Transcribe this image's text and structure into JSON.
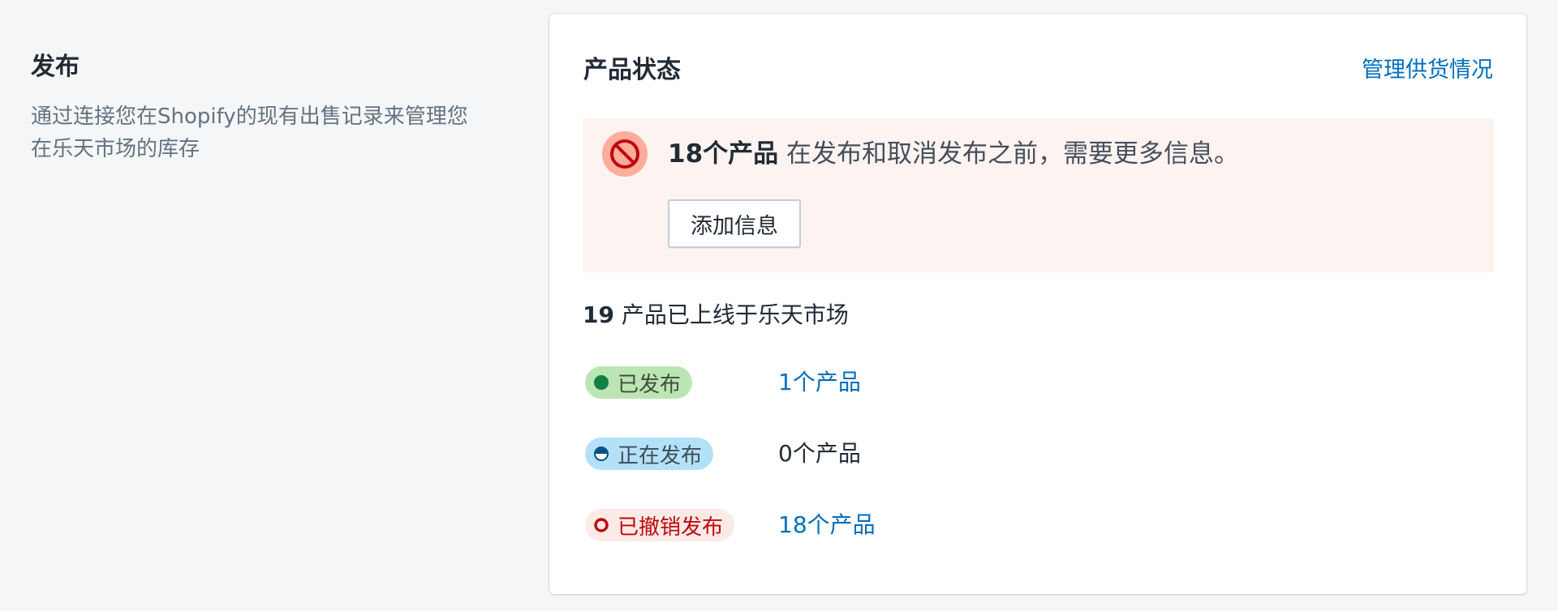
{
  "annotation": {
    "title": "发布",
    "description": "通过连接您在Shopify的现有出售记录来管理您在乐天市场的库存"
  },
  "card": {
    "title": "产品状态",
    "action_label": "管理供货情况"
  },
  "banner": {
    "icon": "blocked-icon",
    "strong_text": "18个产品",
    "message": " 在发布和取消发布之前，需要更多信息。",
    "button_label": "添加信息"
  },
  "summary": {
    "count": "19",
    "text": " 产品已上线于乐天市场"
  },
  "statuses": [
    {
      "label": "已发布",
      "count_text": "1个产品",
      "is_link": true,
      "badge_bg": "#bbe5b3",
      "badge_color": "#414f3e",
      "dot": "filled-green"
    },
    {
      "label": "正在发布",
      "count_text": "0个产品",
      "is_link": false,
      "badge_bg": "#b4e1fa",
      "badge_color": "#3e4e57",
      "dot": "half-blue"
    },
    {
      "label": "已撤销发布",
      "count_text": "18个产品",
      "is_link": true,
      "badge_bg": "#fbeae5",
      "badge_color": "#bf0711",
      "dot": "ring-red"
    }
  ],
  "colors": {
    "link": "#006fbb",
    "banner_bg": "#fdf3f1",
    "critical": "#de3618"
  }
}
